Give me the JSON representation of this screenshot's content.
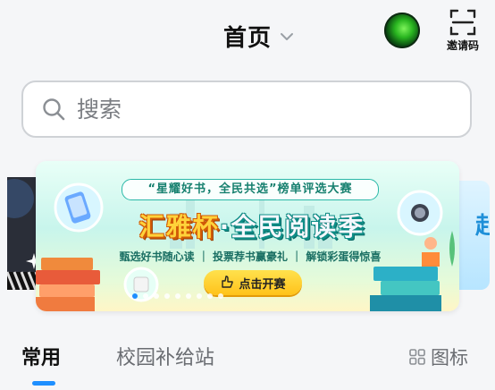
{
  "header": {
    "title": "首页",
    "invite_label": "邀请码"
  },
  "search": {
    "placeholder": "搜索"
  },
  "banner": {
    "tagline": "“星耀好书，全民共选”榜单评选大赛",
    "headline_part1": "汇雅杯",
    "headline_sep": "·",
    "headline_part2": "全民阅读季",
    "subline": "甄选好书随心读 ｜ 投票荐书赢豪礼 ｜ 解锁彩蛋得惊喜",
    "button_label": "点击开赛",
    "carousel_active_index": 0,
    "carousel_count": 9
  },
  "side_cards": {
    "right_glyph": "赴"
  },
  "tabs": {
    "items": [
      "常用",
      "校园补给站"
    ],
    "active": "常用",
    "icon_toggle_label": "图标"
  },
  "colors": {
    "accent": "#1e8fff",
    "banner_teal": "#0d8f88",
    "banner_yellow": "#ffd23a"
  }
}
